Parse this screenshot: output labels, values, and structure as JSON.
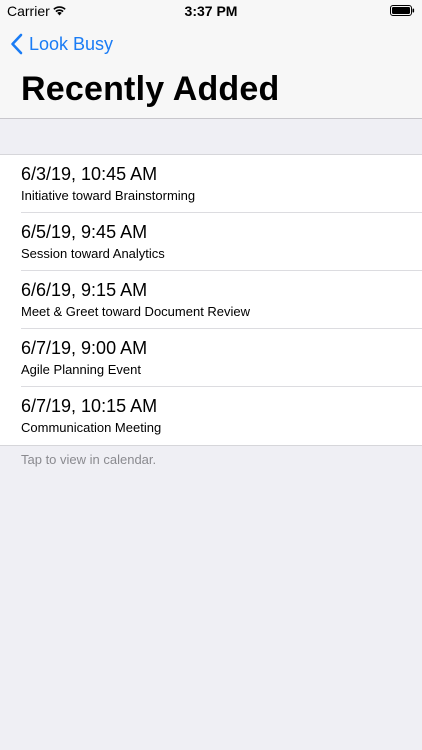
{
  "status_bar": {
    "carrier": "Carrier",
    "time": "3:37 PM",
    "icons": [
      "wifi-icon",
      "battery-icon"
    ]
  },
  "nav": {
    "back_label": "Look Busy",
    "back_icon": "chevron-left-icon",
    "title": "Recently Added"
  },
  "colors": {
    "accent": "#1a7cf5",
    "background": "#efeff4",
    "footer_text": "#8a8a8f"
  },
  "events": [
    {
      "datetime": "6/3/19, 10:45 AM",
      "name": "Initiative toward Brainstorming"
    },
    {
      "datetime": "6/5/19, 9:45 AM",
      "name": "Session toward Analytics"
    },
    {
      "datetime": "6/6/19, 9:15 AM",
      "name": "Meet & Greet toward Document Review"
    },
    {
      "datetime": "6/7/19, 9:00 AM",
      "name": "Agile Planning Event"
    },
    {
      "datetime": "6/7/19, 10:15 AM",
      "name": "Communication Meeting"
    }
  ],
  "footer": {
    "text": "Tap to view in calendar."
  }
}
